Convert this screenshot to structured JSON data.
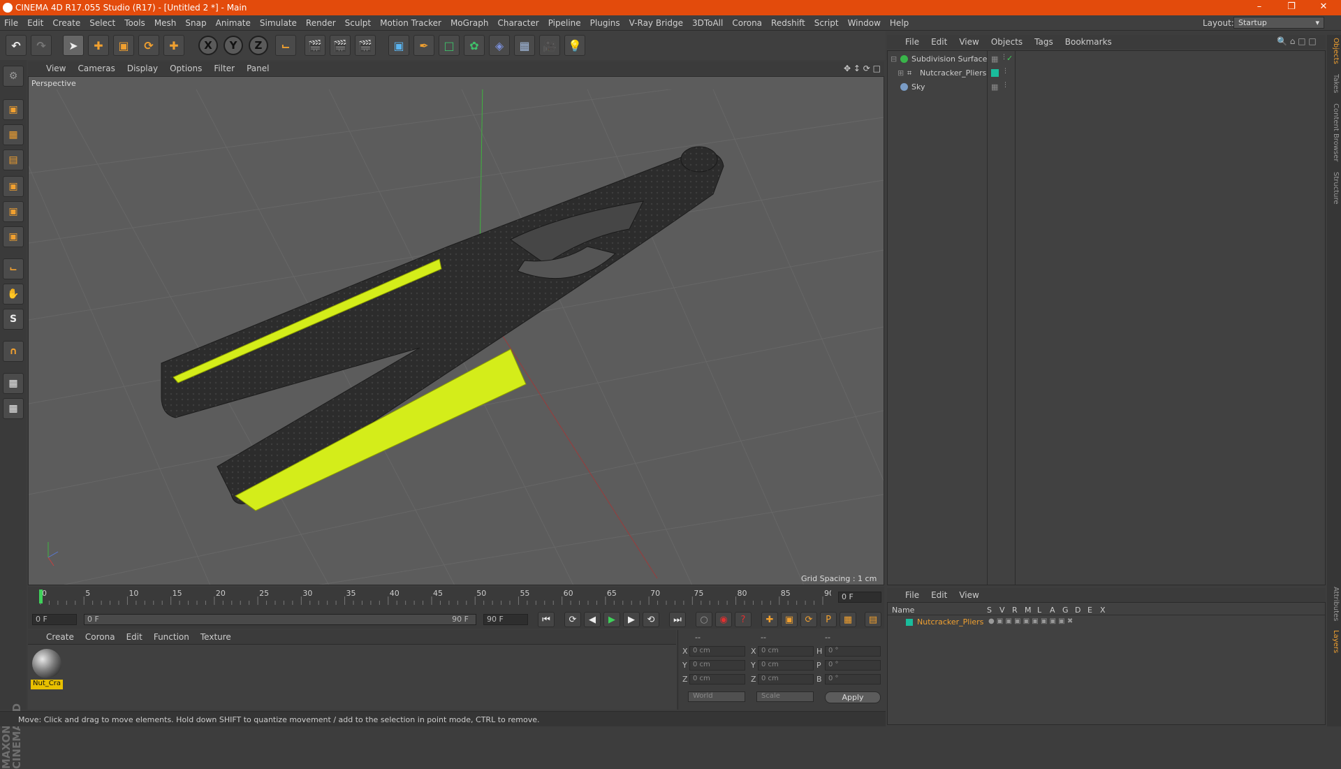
{
  "window": {
    "title": "CINEMA 4D R17.055 Studio (R17) - [Untitled 2 *] - Main"
  },
  "menubar": {
    "items": [
      "File",
      "Edit",
      "Create",
      "Select",
      "Tools",
      "Mesh",
      "Snap",
      "Animate",
      "Simulate",
      "Render",
      "Sculpt",
      "Motion Tracker",
      "MoGraph",
      "Character",
      "Pipeline",
      "Plugins",
      "V-Ray Bridge",
      "3DToAll",
      "Corona",
      "Redshift",
      "Script",
      "Window",
      "Help"
    ],
    "layout_label": "Layout:",
    "layout_value": "Startup"
  },
  "toolbar": {
    "axis_x": "X",
    "axis_y": "Y",
    "axis_z": "Z"
  },
  "viewport": {
    "menu": [
      "View",
      "Cameras",
      "Display",
      "Options",
      "Filter",
      "Panel"
    ],
    "label": "Perspective",
    "grid_status": "Grid Spacing : 1 cm"
  },
  "timeline": {
    "ticks": [
      "0",
      "5",
      "10",
      "15",
      "20",
      "25",
      "30",
      "35",
      "40",
      "45",
      "50",
      "55",
      "60",
      "65",
      "70",
      "75",
      "80",
      "85",
      "90"
    ],
    "current_frame": "0 F",
    "start_field": "0 F",
    "range_start": "0 F",
    "range_end": "90 F",
    "end_field": "90 F"
  },
  "materials": {
    "menu": [
      "Create",
      "Corona",
      "Edit",
      "Function",
      "Texture"
    ],
    "items": [
      {
        "name": "Nut_Cra"
      }
    ]
  },
  "coords": {
    "header": [
      "--",
      "--",
      "--"
    ],
    "rows": [
      {
        "a": "X",
        "av": "0 cm",
        "b": "X",
        "bv": "0 cm",
        "c": "H",
        "cv": "0 °"
      },
      {
        "a": "Y",
        "av": "0 cm",
        "b": "Y",
        "bv": "0 cm",
        "c": "P",
        "cv": "0 °"
      },
      {
        "a": "Z",
        "av": "0 cm",
        "b": "Z",
        "bv": "0 cm",
        "c": "B",
        "cv": "0 °"
      }
    ],
    "space": "World",
    "mode": "Scale",
    "apply": "Apply"
  },
  "status": {
    "text": "Move: Click and drag to move elements. Hold down SHIFT to quantize movement / add to the selection in point mode, CTRL to remove."
  },
  "objects": {
    "menu": [
      "File",
      "Edit",
      "View",
      "Objects",
      "Tags",
      "Bookmarks"
    ],
    "items": [
      {
        "name": "Subdivision Surface",
        "color": "#39b54a"
      },
      {
        "name": "Nutcracker_Pliers",
        "color": "#1abc9c"
      },
      {
        "name": "Sky",
        "color": "#7a9cc6"
      }
    ]
  },
  "layers": {
    "menu": [
      "File",
      "Edit",
      "View"
    ],
    "columns": [
      "Name",
      "S",
      "V",
      "R",
      "M",
      "L",
      "A",
      "G",
      "D",
      "E",
      "X"
    ],
    "items": [
      {
        "name": "Nutcracker_Pliers",
        "color": "#1abc9c"
      }
    ]
  },
  "right_tabs": [
    "Objects",
    "Takes",
    "Content Browser",
    "Structure",
    "Attributes",
    "Layers"
  ],
  "branding": {
    "logo_text": "MAXON CINEMA 4D"
  },
  "colors": {
    "titlebar": "#e34b0c",
    "handle": "#d4ed1a",
    "pliers": "#2d2d2d"
  }
}
